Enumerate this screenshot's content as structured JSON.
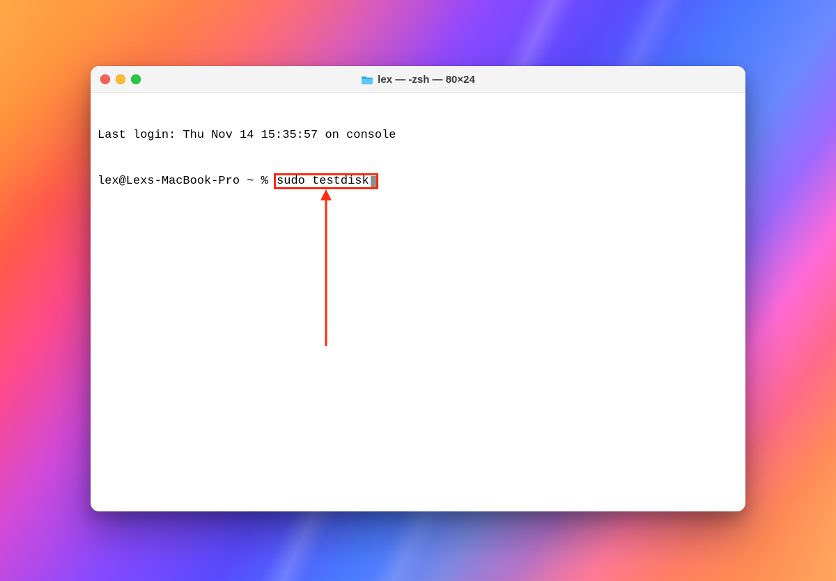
{
  "window": {
    "title": "lex — -zsh — 80×24"
  },
  "terminal": {
    "last_login": "Last login: Thu Nov 14 15:35:57 on console",
    "prompt": "lex@Lexs-MacBook-Pro ~ % ",
    "command": "sudo testdisk"
  },
  "annotation": {
    "color": "#ff2a12"
  }
}
